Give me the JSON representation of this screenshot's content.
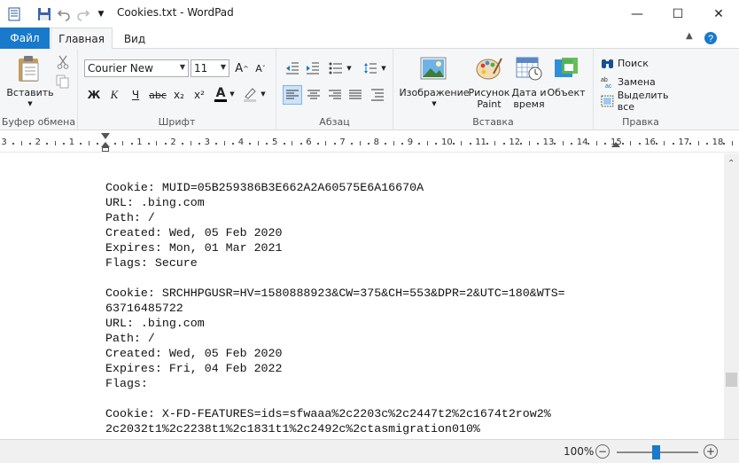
{
  "window": {
    "title": "Cookies.txt - WordPad",
    "minimize_glyph": "—",
    "maximize_glyph": "☐",
    "close_glyph": "✕"
  },
  "ribbon_tabs": {
    "file": "Файл",
    "home": "Главная",
    "view": "Вид"
  },
  "clipboard": {
    "paste_label": "Вставить",
    "group_label": "Буфер обмена"
  },
  "font": {
    "family": "Courier New",
    "size": "11",
    "bold": "Ж",
    "italic": "К",
    "underline": "Ч",
    "strike": "abc",
    "subscript": "x₂",
    "superscript": "x²",
    "font_color_glyph": "A",
    "group_label": "Шрифт"
  },
  "paragraph": {
    "group_label": "Абзац"
  },
  "insert": {
    "picture": "Изображение",
    "paint": "Рисунок Paint",
    "datetime": "Дата и время",
    "object": "Объект",
    "group_label": "Вставка"
  },
  "editing": {
    "find": "Поиск",
    "replace": "Замена",
    "select_all": "Выделить все",
    "group_label": "Правка"
  },
  "ruler": {
    "numbers": [
      "3",
      "2",
      "1",
      "1",
      "2",
      "3",
      "4",
      "5",
      "6",
      "7",
      "8",
      "9",
      "10",
      "11",
      "12",
      "13",
      "14",
      "15",
      "16",
      "17",
      "18"
    ]
  },
  "document": {
    "lines": [
      "Cookie: MUID=05B259386B3E662A2A60575E6A16670A",
      "URL: .bing.com",
      "Path: /",
      "Created: Wed, 05 Feb 2020",
      "Expires: Mon, 01 Mar 2021",
      "Flags: Secure",
      "",
      "Cookie: SRCHHPGUSR=HV=1580888923&CW=375&CH=553&DPR=2&UTC=180&WTS=",
      "63716485722",
      "URL: .bing.com",
      "Path: /",
      "Created: Wed, 05 Feb 2020",
      "Expires: Fri, 04 Feb 2022",
      "Flags:",
      "",
      "Cookie: X-FD-FEATURES=ids=sfwaaa%2c2203c%2c2447t2%2c1674t2row2%",
      "2c2032t1%2c2238t1%2c1831t1%2c2492c%2ctasmigration010%"
    ]
  },
  "status": {
    "zoom": "100%",
    "zoom_level": 1.0,
    "zoom_out": "−",
    "zoom_in": "+"
  },
  "colors": {
    "accent": "#1979ca",
    "ribbon_bg": "#f5f6f7"
  }
}
